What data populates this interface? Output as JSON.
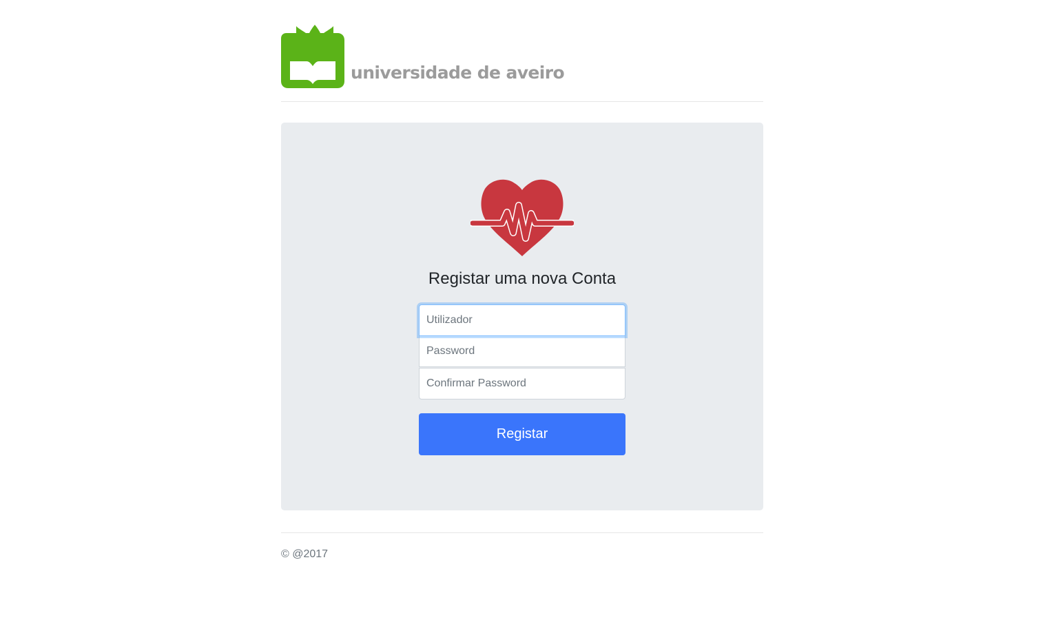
{
  "header": {
    "logo_text": "universidade de aveiro",
    "logo_color": "#5bb318"
  },
  "register": {
    "heart_color": "#c8373f",
    "title": "Registar uma nova Conta",
    "username_placeholder": "Utilizador",
    "password_placeholder": "Password",
    "confirm_password_placeholder": "Confirmar Password",
    "submit_label": "Registar",
    "button_color": "#3a75fb"
  },
  "footer": {
    "copyright": "© @2017"
  }
}
